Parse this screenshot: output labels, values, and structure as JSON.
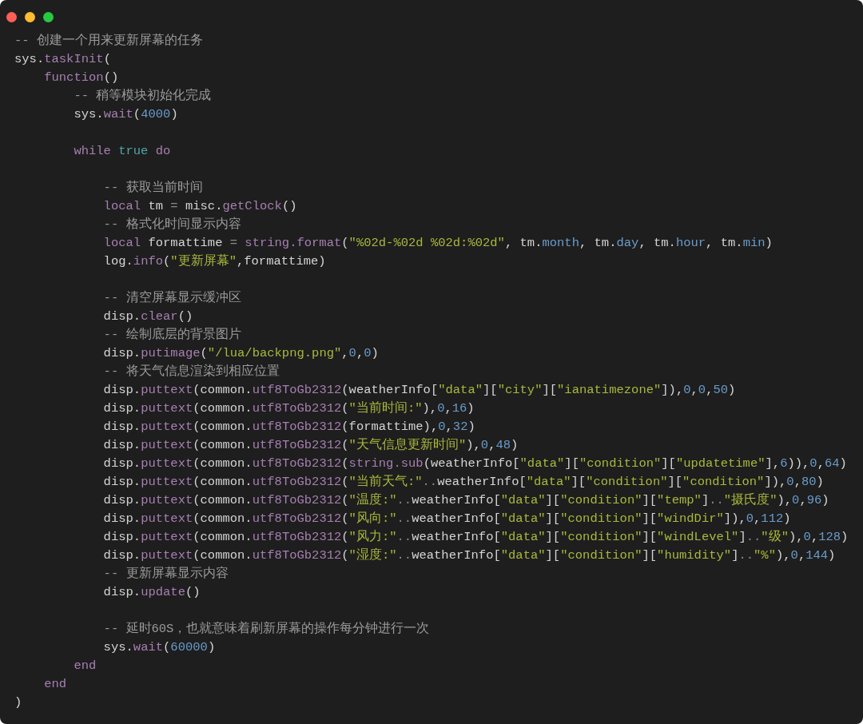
{
  "window": {
    "controls": [
      {
        "color": "#ff5f57"
      },
      {
        "color": "#febc2e"
      },
      {
        "color": "#28c840"
      }
    ]
  },
  "lines": [
    {
      "kind": "code",
      "tokens": [
        {
          "kind": "comment",
          "text": "-- 创建一个用来更新屏幕的任务"
        }
      ]
    },
    {
      "kind": "code",
      "tokens": [
        {
          "kind": "plain",
          "text": "sys."
        },
        {
          "kind": "call",
          "text": "taskInit"
        },
        {
          "kind": "plain",
          "text": "("
        }
      ],
      "children": [
        {
          "kind": "code",
          "tokens": [
            {
              "kind": "keyword",
              "text": "function"
            },
            {
              "kind": "plain",
              "text": "()"
            }
          ],
          "children": [
            {
              "kind": "code",
              "tokens": [
                {
                  "kind": "comment",
                  "text": "-- 稍等模块初始化完成"
                }
              ]
            },
            {
              "kind": "code",
              "tokens": [
                {
                  "kind": "plain",
                  "text": "sys."
                },
                {
                  "kind": "call",
                  "text": "wait"
                },
                {
                  "kind": "plain",
                  "text": "("
                },
                {
                  "kind": "number",
                  "text": "4000"
                },
                {
                  "kind": "plain",
                  "text": ")"
                }
              ]
            },
            {
              "kind": "blank"
            },
            {
              "kind": "code",
              "tokens": [
                {
                  "kind": "keyword",
                  "text": "while"
                },
                {
                  "kind": "constant",
                  "text": "true",
                  "space_before": true
                },
                {
                  "kind": "keyword",
                  "text": "do",
                  "space_before": true
                }
              ],
              "children": [
                {
                  "kind": "blank"
                },
                {
                  "kind": "code",
                  "tokens": [
                    {
                      "kind": "comment",
                      "text": "-- 获取当前时间"
                    }
                  ]
                },
                {
                  "kind": "code",
                  "tokens": [
                    {
                      "kind": "keyword",
                      "text": "local"
                    },
                    {
                      "kind": "plain",
                      "text": "tm",
                      "space_before": true
                    },
                    {
                      "kind": "operator",
                      "text": "=",
                      "space_before": true
                    },
                    {
                      "kind": "plain",
                      "text": "misc.",
                      "space_before": true
                    },
                    {
                      "kind": "call",
                      "text": "getClock"
                    },
                    {
                      "kind": "plain",
                      "text": "()"
                    }
                  ]
                },
                {
                  "kind": "code",
                  "tokens": [
                    {
                      "kind": "comment",
                      "text": "-- 格式化时间显示内容"
                    }
                  ]
                },
                {
                  "kind": "code",
                  "tokens": [
                    {
                      "kind": "keyword",
                      "text": "local"
                    },
                    {
                      "kind": "plain",
                      "text": "formattime",
                      "space_before": true
                    },
                    {
                      "kind": "operator",
                      "text": "=",
                      "space_before": true
                    },
                    {
                      "kind": "call",
                      "text": "string.format",
                      "space_before": true
                    },
                    {
                      "kind": "plain",
                      "text": "("
                    },
                    {
                      "kind": "string",
                      "text": "\"%02d-%02d %02d:%02d\""
                    },
                    {
                      "kind": "plain",
                      "text": ","
                    },
                    {
                      "kind": "plain",
                      "text": "tm.",
                      "space_before": true
                    },
                    {
                      "kind": "field",
                      "text": "month"
                    },
                    {
                      "kind": "plain",
                      "text": ","
                    },
                    {
                      "kind": "plain",
                      "text": "tm.",
                      "space_before": true
                    },
                    {
                      "kind": "field",
                      "text": "day"
                    },
                    {
                      "kind": "plain",
                      "text": ","
                    },
                    {
                      "kind": "plain",
                      "text": "tm.",
                      "space_before": true
                    },
                    {
                      "kind": "field",
                      "text": "hour"
                    },
                    {
                      "kind": "plain",
                      "text": ","
                    },
                    {
                      "kind": "plain",
                      "text": "tm.",
                      "space_before": true
                    },
                    {
                      "kind": "field",
                      "text": "min"
                    },
                    {
                      "kind": "plain",
                      "text": ")"
                    }
                  ]
                },
                {
                  "kind": "code",
                  "tokens": [
                    {
                      "kind": "plain",
                      "text": "log."
                    },
                    {
                      "kind": "call",
                      "text": "info"
                    },
                    {
                      "kind": "plain",
                      "text": "("
                    },
                    {
                      "kind": "string",
                      "text": "\"更新屏幕\""
                    },
                    {
                      "kind": "plain",
                      "text": ",formattime)"
                    }
                  ]
                },
                {
                  "kind": "blank"
                },
                {
                  "kind": "code",
                  "tokens": [
                    {
                      "kind": "comment",
                      "text": "-- 清空屏幕显示缓冲区"
                    }
                  ]
                },
                {
                  "kind": "code",
                  "tokens": [
                    {
                      "kind": "plain",
                      "text": "disp."
                    },
                    {
                      "kind": "call",
                      "text": "clear"
                    },
                    {
                      "kind": "plain",
                      "text": "()"
                    }
                  ]
                },
                {
                  "kind": "code",
                  "tokens": [
                    {
                      "kind": "comment",
                      "text": "-- 绘制底层的背景图片"
                    }
                  ]
                },
                {
                  "kind": "code",
                  "tokens": [
                    {
                      "kind": "plain",
                      "text": "disp."
                    },
                    {
                      "kind": "call",
                      "text": "putimage"
                    },
                    {
                      "kind": "plain",
                      "text": "("
                    },
                    {
                      "kind": "string",
                      "text": "\"/lua/backpng.png\""
                    },
                    {
                      "kind": "plain",
                      "text": ","
                    },
                    {
                      "kind": "number",
                      "text": "0"
                    },
                    {
                      "kind": "plain",
                      "text": ","
                    },
                    {
                      "kind": "number",
                      "text": "0"
                    },
                    {
                      "kind": "plain",
                      "text": ")"
                    }
                  ]
                },
                {
                  "kind": "code",
                  "tokens": [
                    {
                      "kind": "comment",
                      "text": "-- 将天气信息渲染到相应位置"
                    }
                  ]
                },
                {
                  "kind": "code",
                  "tokens": [
                    {
                      "kind": "plain",
                      "text": "disp."
                    },
                    {
                      "kind": "call",
                      "text": "puttext"
                    },
                    {
                      "kind": "plain",
                      "text": "(common."
                    },
                    {
                      "kind": "call",
                      "text": "utf8ToGb2312"
                    },
                    {
                      "kind": "plain",
                      "text": "(weatherInfo["
                    },
                    {
                      "kind": "string",
                      "text": "\"data\""
                    },
                    {
                      "kind": "plain",
                      "text": "]["
                    },
                    {
                      "kind": "string",
                      "text": "\"city\""
                    },
                    {
                      "kind": "plain",
                      "text": "]["
                    },
                    {
                      "kind": "string",
                      "text": "\"ianatimezone\""
                    },
                    {
                      "kind": "plain",
                      "text": "]),"
                    },
                    {
                      "kind": "number",
                      "text": "0"
                    },
                    {
                      "kind": "plain",
                      "text": ","
                    },
                    {
                      "kind": "number",
                      "text": "0"
                    },
                    {
                      "kind": "plain",
                      "text": ","
                    },
                    {
                      "kind": "number",
                      "text": "50"
                    },
                    {
                      "kind": "plain",
                      "text": ")"
                    }
                  ]
                },
                {
                  "kind": "code",
                  "tokens": [
                    {
                      "kind": "plain",
                      "text": "disp."
                    },
                    {
                      "kind": "call",
                      "text": "puttext"
                    },
                    {
                      "kind": "plain",
                      "text": "(common."
                    },
                    {
                      "kind": "call",
                      "text": "utf8ToGb2312"
                    },
                    {
                      "kind": "plain",
                      "text": "("
                    },
                    {
                      "kind": "string",
                      "text": "\"当前时间:\""
                    },
                    {
                      "kind": "plain",
                      "text": "),"
                    },
                    {
                      "kind": "number",
                      "text": "0"
                    },
                    {
                      "kind": "plain",
                      "text": ","
                    },
                    {
                      "kind": "number",
                      "text": "16"
                    },
                    {
                      "kind": "plain",
                      "text": ")"
                    }
                  ]
                },
                {
                  "kind": "code",
                  "tokens": [
                    {
                      "kind": "plain",
                      "text": "disp."
                    },
                    {
                      "kind": "call",
                      "text": "puttext"
                    },
                    {
                      "kind": "plain",
                      "text": "(common."
                    },
                    {
                      "kind": "call",
                      "text": "utf8ToGb2312"
                    },
                    {
                      "kind": "plain",
                      "text": "(formattime),"
                    },
                    {
                      "kind": "number",
                      "text": "0"
                    },
                    {
                      "kind": "plain",
                      "text": ","
                    },
                    {
                      "kind": "number",
                      "text": "32"
                    },
                    {
                      "kind": "plain",
                      "text": ")"
                    }
                  ]
                },
                {
                  "kind": "code",
                  "tokens": [
                    {
                      "kind": "plain",
                      "text": "disp."
                    },
                    {
                      "kind": "call",
                      "text": "puttext"
                    },
                    {
                      "kind": "plain",
                      "text": "(common."
                    },
                    {
                      "kind": "call",
                      "text": "utf8ToGb2312"
                    },
                    {
                      "kind": "plain",
                      "text": "("
                    },
                    {
                      "kind": "string",
                      "text": "\"天气信息更新时间\""
                    },
                    {
                      "kind": "plain",
                      "text": "),"
                    },
                    {
                      "kind": "number",
                      "text": "0"
                    },
                    {
                      "kind": "plain",
                      "text": ","
                    },
                    {
                      "kind": "number",
                      "text": "48"
                    },
                    {
                      "kind": "plain",
                      "text": ")"
                    }
                  ]
                },
                {
                  "kind": "code",
                  "tokens": [
                    {
                      "kind": "plain",
                      "text": "disp."
                    },
                    {
                      "kind": "call",
                      "text": "puttext"
                    },
                    {
                      "kind": "plain",
                      "text": "(common."
                    },
                    {
                      "kind": "call",
                      "text": "utf8ToGb2312"
                    },
                    {
                      "kind": "plain",
                      "text": "("
                    },
                    {
                      "kind": "call",
                      "text": "string.sub"
                    },
                    {
                      "kind": "plain",
                      "text": "(weatherInfo["
                    },
                    {
                      "kind": "string",
                      "text": "\"data\""
                    },
                    {
                      "kind": "plain",
                      "text": "]["
                    },
                    {
                      "kind": "string",
                      "text": "\"condition\""
                    },
                    {
                      "kind": "plain",
                      "text": "]["
                    },
                    {
                      "kind": "string",
                      "text": "\"updatetime\""
                    },
                    {
                      "kind": "plain",
                      "text": "],"
                    },
                    {
                      "kind": "number",
                      "text": "6"
                    },
                    {
                      "kind": "plain",
                      "text": ")),"
                    },
                    {
                      "kind": "number",
                      "text": "0"
                    },
                    {
                      "kind": "plain",
                      "text": ","
                    },
                    {
                      "kind": "number",
                      "text": "64"
                    },
                    {
                      "kind": "plain",
                      "text": ")"
                    }
                  ]
                },
                {
                  "kind": "code",
                  "tokens": [
                    {
                      "kind": "plain",
                      "text": "disp."
                    },
                    {
                      "kind": "call",
                      "text": "puttext"
                    },
                    {
                      "kind": "plain",
                      "text": "(common."
                    },
                    {
                      "kind": "call",
                      "text": "utf8ToGb2312"
                    },
                    {
                      "kind": "plain",
                      "text": "("
                    },
                    {
                      "kind": "string",
                      "text": "\"当前天气:\""
                    },
                    {
                      "kind": "operator",
                      "text": ".."
                    },
                    {
                      "kind": "plain",
                      "text": "weatherInfo["
                    },
                    {
                      "kind": "string",
                      "text": "\"data\""
                    },
                    {
                      "kind": "plain",
                      "text": "]["
                    },
                    {
                      "kind": "string",
                      "text": "\"condition\""
                    },
                    {
                      "kind": "plain",
                      "text": "]["
                    },
                    {
                      "kind": "string",
                      "text": "\"condition\""
                    },
                    {
                      "kind": "plain",
                      "text": "]),"
                    },
                    {
                      "kind": "number",
                      "text": "0"
                    },
                    {
                      "kind": "plain",
                      "text": ","
                    },
                    {
                      "kind": "number",
                      "text": "80"
                    },
                    {
                      "kind": "plain",
                      "text": ")"
                    }
                  ]
                },
                {
                  "kind": "code",
                  "tokens": [
                    {
                      "kind": "plain",
                      "text": "disp."
                    },
                    {
                      "kind": "call",
                      "text": "puttext"
                    },
                    {
                      "kind": "plain",
                      "text": "(common."
                    },
                    {
                      "kind": "call",
                      "text": "utf8ToGb2312"
                    },
                    {
                      "kind": "plain",
                      "text": "("
                    },
                    {
                      "kind": "string",
                      "text": "\"温度:\""
                    },
                    {
                      "kind": "operator",
                      "text": ".."
                    },
                    {
                      "kind": "plain",
                      "text": "weatherInfo["
                    },
                    {
                      "kind": "string",
                      "text": "\"data\""
                    },
                    {
                      "kind": "plain",
                      "text": "]["
                    },
                    {
                      "kind": "string",
                      "text": "\"condition\""
                    },
                    {
                      "kind": "plain",
                      "text": "]["
                    },
                    {
                      "kind": "string",
                      "text": "\"temp\""
                    },
                    {
                      "kind": "plain",
                      "text": "]"
                    },
                    {
                      "kind": "operator",
                      "text": ".."
                    },
                    {
                      "kind": "string",
                      "text": "\"摄氏度\""
                    },
                    {
                      "kind": "plain",
                      "text": "),"
                    },
                    {
                      "kind": "number",
                      "text": "0"
                    },
                    {
                      "kind": "plain",
                      "text": ","
                    },
                    {
                      "kind": "number",
                      "text": "96"
                    },
                    {
                      "kind": "plain",
                      "text": ")"
                    }
                  ]
                },
                {
                  "kind": "code",
                  "tokens": [
                    {
                      "kind": "plain",
                      "text": "disp."
                    },
                    {
                      "kind": "call",
                      "text": "puttext"
                    },
                    {
                      "kind": "plain",
                      "text": "(common."
                    },
                    {
                      "kind": "call",
                      "text": "utf8ToGb2312"
                    },
                    {
                      "kind": "plain",
                      "text": "("
                    },
                    {
                      "kind": "string",
                      "text": "\"风向:\""
                    },
                    {
                      "kind": "operator",
                      "text": ".."
                    },
                    {
                      "kind": "plain",
                      "text": "weatherInfo["
                    },
                    {
                      "kind": "string",
                      "text": "\"data\""
                    },
                    {
                      "kind": "plain",
                      "text": "]["
                    },
                    {
                      "kind": "string",
                      "text": "\"condition\""
                    },
                    {
                      "kind": "plain",
                      "text": "]["
                    },
                    {
                      "kind": "string",
                      "text": "\"windDir\""
                    },
                    {
                      "kind": "plain",
                      "text": "]),"
                    },
                    {
                      "kind": "number",
                      "text": "0"
                    },
                    {
                      "kind": "plain",
                      "text": ","
                    },
                    {
                      "kind": "number",
                      "text": "112"
                    },
                    {
                      "kind": "plain",
                      "text": ")"
                    }
                  ]
                },
                {
                  "kind": "code",
                  "tokens": [
                    {
                      "kind": "plain",
                      "text": "disp."
                    },
                    {
                      "kind": "call",
                      "text": "puttext"
                    },
                    {
                      "kind": "plain",
                      "text": "(common."
                    },
                    {
                      "kind": "call",
                      "text": "utf8ToGb2312"
                    },
                    {
                      "kind": "plain",
                      "text": "("
                    },
                    {
                      "kind": "string",
                      "text": "\"风力:\""
                    },
                    {
                      "kind": "operator",
                      "text": ".."
                    },
                    {
                      "kind": "plain",
                      "text": "weatherInfo["
                    },
                    {
                      "kind": "string",
                      "text": "\"data\""
                    },
                    {
                      "kind": "plain",
                      "text": "]["
                    },
                    {
                      "kind": "string",
                      "text": "\"condition\""
                    },
                    {
                      "kind": "plain",
                      "text": "]["
                    },
                    {
                      "kind": "string",
                      "text": "\"windLevel\""
                    },
                    {
                      "kind": "plain",
                      "text": "]"
                    },
                    {
                      "kind": "operator",
                      "text": ".."
                    },
                    {
                      "kind": "string",
                      "text": "\"级\""
                    },
                    {
                      "kind": "plain",
                      "text": "),"
                    },
                    {
                      "kind": "number",
                      "text": "0"
                    },
                    {
                      "kind": "plain",
                      "text": ","
                    },
                    {
                      "kind": "number",
                      "text": "128"
                    },
                    {
                      "kind": "plain",
                      "text": ")"
                    }
                  ]
                },
                {
                  "kind": "code",
                  "tokens": [
                    {
                      "kind": "plain",
                      "text": "disp."
                    },
                    {
                      "kind": "call",
                      "text": "puttext"
                    },
                    {
                      "kind": "plain",
                      "text": "(common."
                    },
                    {
                      "kind": "call",
                      "text": "utf8ToGb2312"
                    },
                    {
                      "kind": "plain",
                      "text": "("
                    },
                    {
                      "kind": "string",
                      "text": "\"湿度:\""
                    },
                    {
                      "kind": "operator",
                      "text": ".."
                    },
                    {
                      "kind": "plain",
                      "text": "weatherInfo["
                    },
                    {
                      "kind": "string",
                      "text": "\"data\""
                    },
                    {
                      "kind": "plain",
                      "text": "]["
                    },
                    {
                      "kind": "string",
                      "text": "\"condition\""
                    },
                    {
                      "kind": "plain",
                      "text": "]["
                    },
                    {
                      "kind": "string",
                      "text": "\"humidity\""
                    },
                    {
                      "kind": "plain",
                      "text": "]"
                    },
                    {
                      "kind": "operator",
                      "text": ".."
                    },
                    {
                      "kind": "string",
                      "text": "\"%\""
                    },
                    {
                      "kind": "plain",
                      "text": "),"
                    },
                    {
                      "kind": "number",
                      "text": "0"
                    },
                    {
                      "kind": "plain",
                      "text": ","
                    },
                    {
                      "kind": "number",
                      "text": "144"
                    },
                    {
                      "kind": "plain",
                      "text": ")"
                    }
                  ]
                },
                {
                  "kind": "code",
                  "tokens": [
                    {
                      "kind": "comment",
                      "text": "-- 更新屏幕显示内容"
                    }
                  ]
                },
                {
                  "kind": "code",
                  "tokens": [
                    {
                      "kind": "plain",
                      "text": "disp."
                    },
                    {
                      "kind": "call",
                      "text": "update"
                    },
                    {
                      "kind": "plain",
                      "text": "()"
                    }
                  ]
                },
                {
                  "kind": "blank"
                },
                {
                  "kind": "code",
                  "tokens": [
                    {
                      "kind": "comment",
                      "text": "-- 延时60S，也就意味着刷新屏幕的操作每分钟进行一次"
                    }
                  ]
                },
                {
                  "kind": "code",
                  "tokens": [
                    {
                      "kind": "plain",
                      "text": "sys."
                    },
                    {
                      "kind": "call",
                      "text": "wait"
                    },
                    {
                      "kind": "plain",
                      "text": "("
                    },
                    {
                      "kind": "number",
                      "text": "60000"
                    },
                    {
                      "kind": "plain",
                      "text": ")"
                    }
                  ]
                }
              ]
            },
            {
              "kind": "code",
              "tokens": [
                {
                  "kind": "keyword",
                  "text": "end"
                }
              ]
            }
          ]
        },
        {
          "kind": "code",
          "tokens": [
            {
              "kind": "keyword",
              "text": "end"
            }
          ]
        }
      ]
    },
    {
      "kind": "code",
      "tokens": [
        {
          "kind": "plain",
          "text": ")"
        }
      ]
    }
  ]
}
